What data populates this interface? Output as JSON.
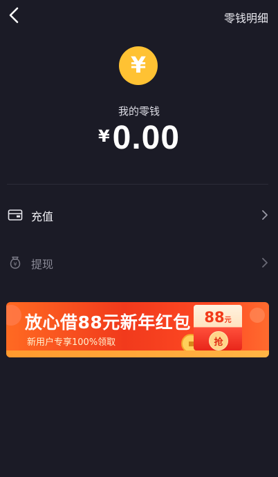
{
  "header": {
    "detail_link": "零钱明细"
  },
  "wallet": {
    "coin_symbol": "¥",
    "label": "我的零钱",
    "currency": "¥",
    "amount": "0.00"
  },
  "menu": [
    {
      "label": "充值",
      "icon": "card-icon",
      "enabled": true
    },
    {
      "label": "提现",
      "icon": "money-bag-icon",
      "enabled": false
    }
  ],
  "banner": {
    "title": "放心借88元新年红包",
    "subtitle": "新用户专享100%领取",
    "packet_amount": "88",
    "packet_unit": "元",
    "packet_button": "抢"
  },
  "colors": {
    "background": "#1b1b26",
    "coin": "#ffc233",
    "banner_red": "#f13a1c"
  }
}
